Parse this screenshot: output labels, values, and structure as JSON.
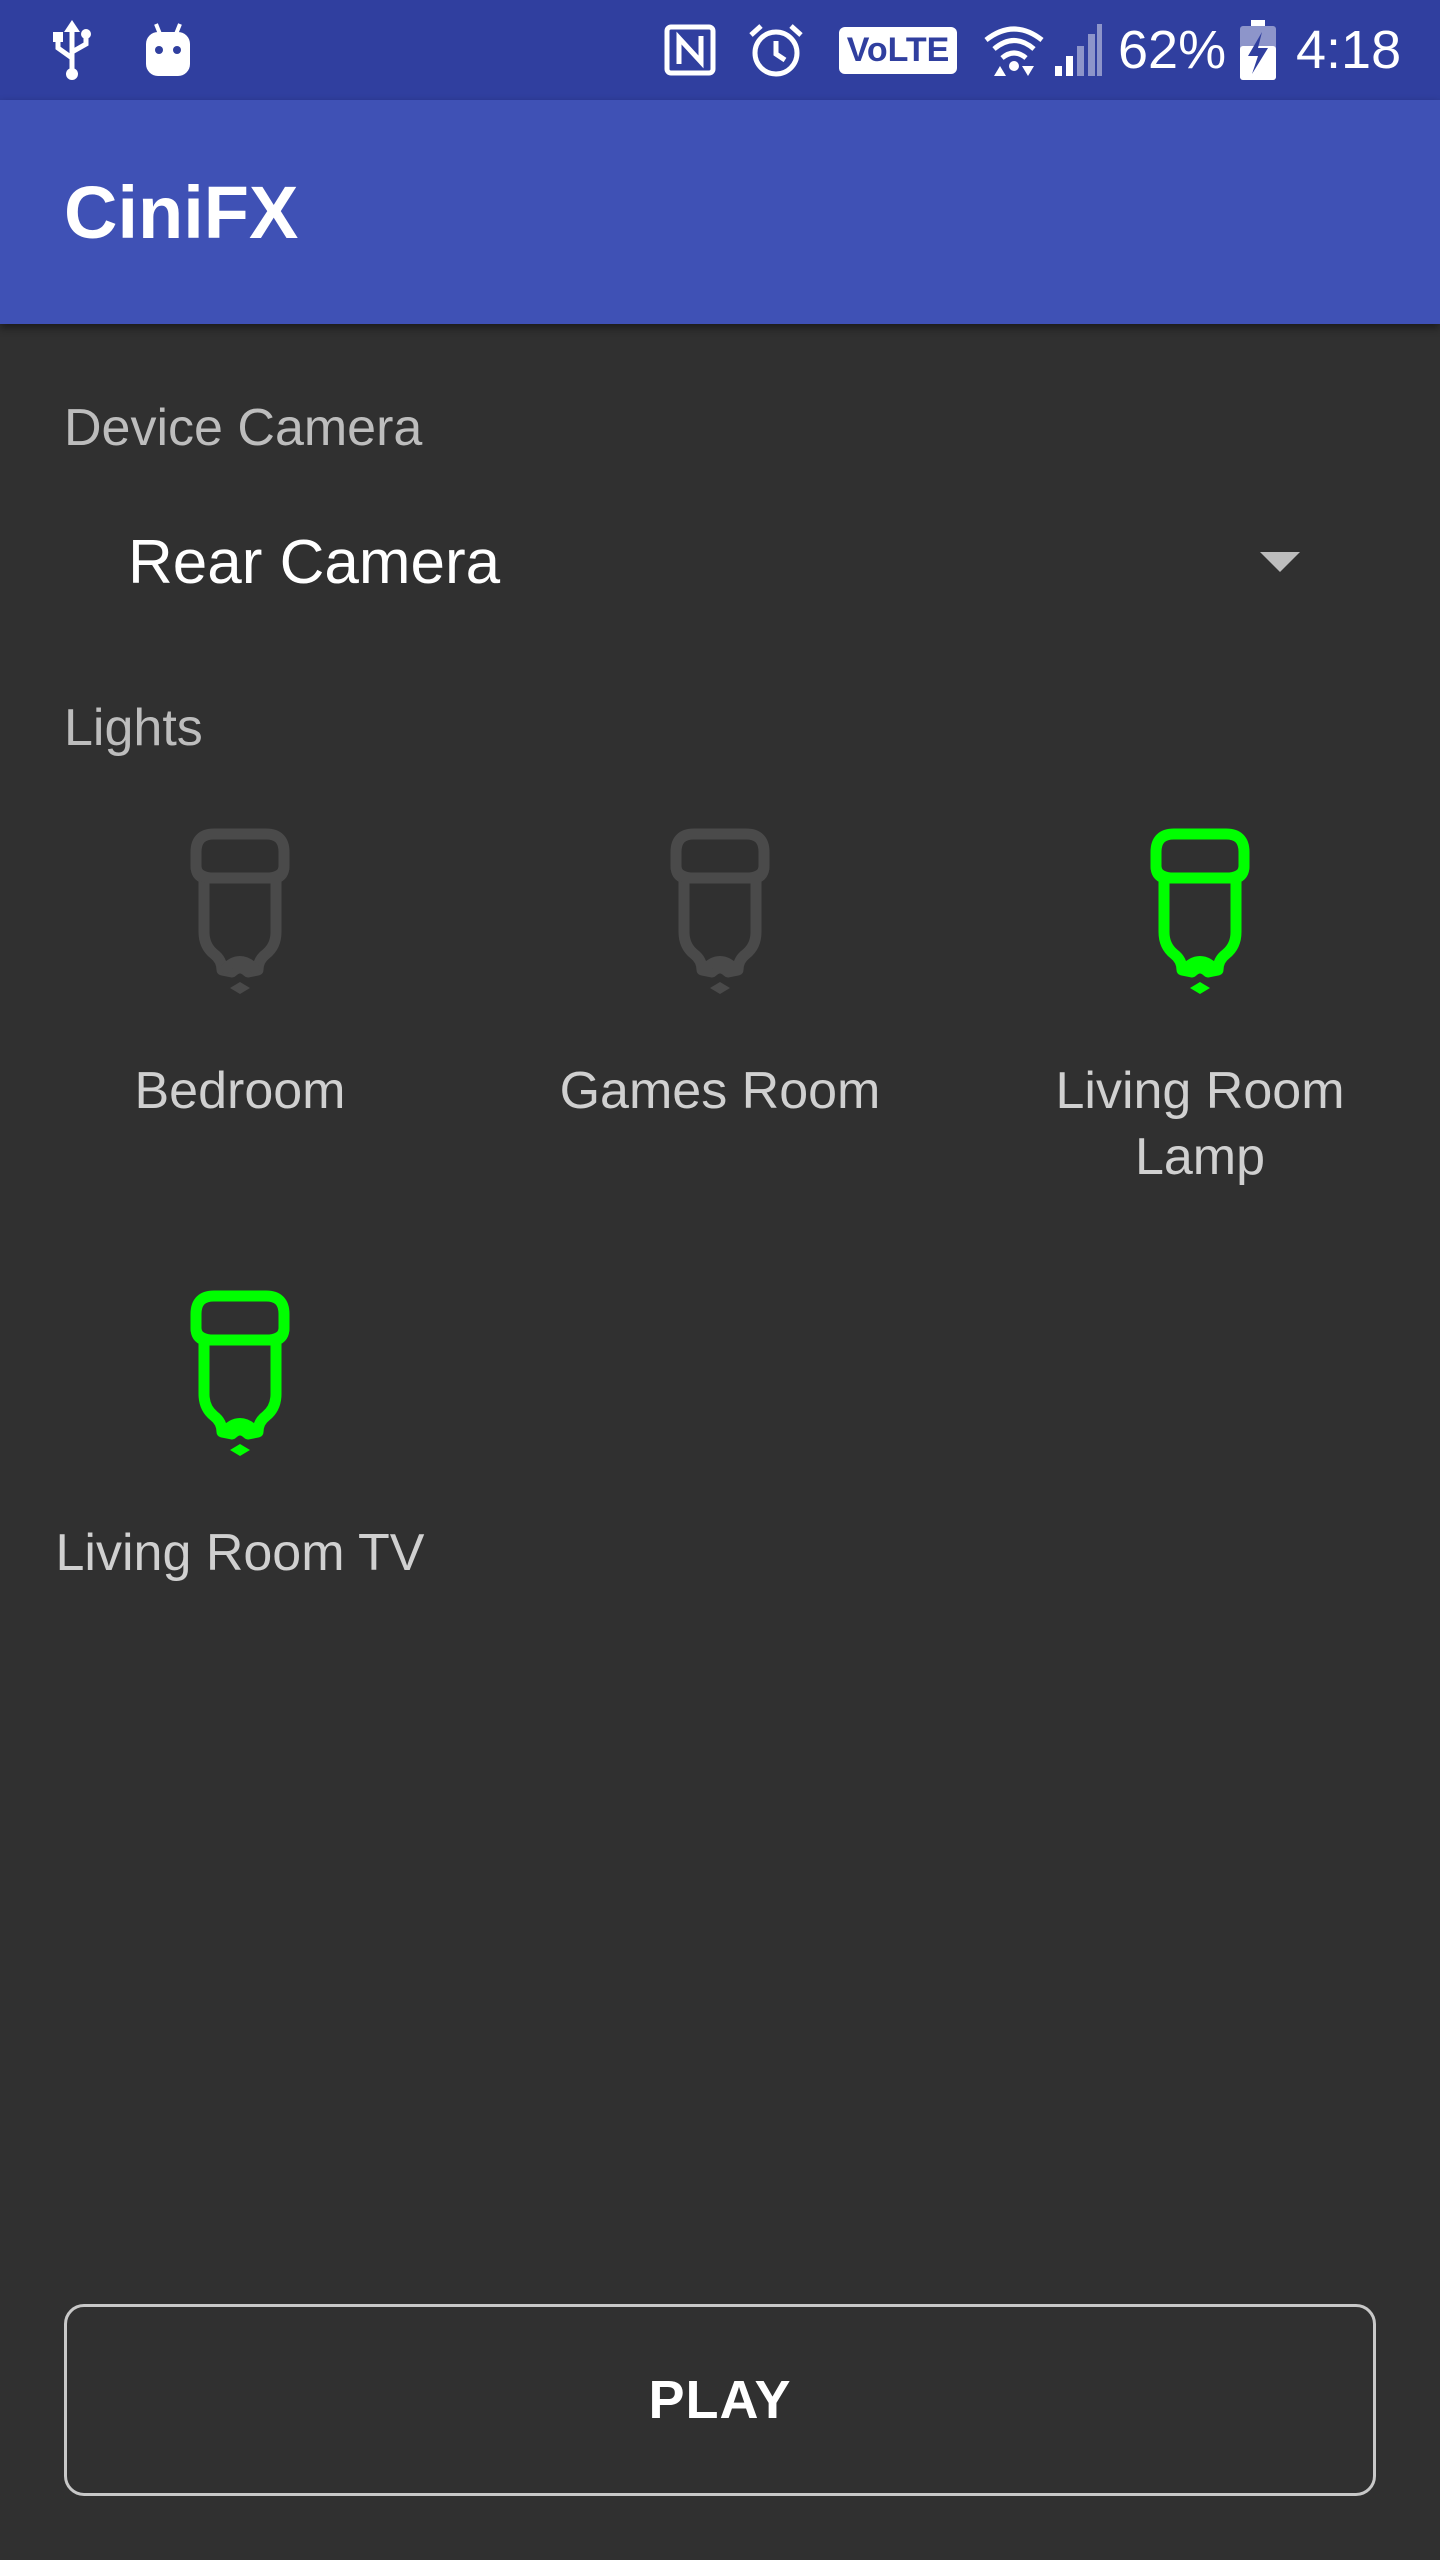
{
  "status_bar": {
    "battery_percent": "62%",
    "time": "4:18",
    "volte_label": "VoLTE",
    "icons": [
      "usb-icon",
      "android-debug-icon",
      "nfc-icon",
      "alarm-icon",
      "volte-icon",
      "wifi-icon",
      "cell-signal-icon",
      "battery-charging-icon"
    ]
  },
  "app_bar": {
    "title": "CiniFX"
  },
  "camera": {
    "label": "Device Camera",
    "selected": "Rear Camera"
  },
  "lights": {
    "label": "Lights",
    "items": [
      {
        "name": "Bedroom",
        "on": false
      },
      {
        "name": "Games Room",
        "on": false
      },
      {
        "name": "Living Room Lamp",
        "on": true
      },
      {
        "name": "Living Room TV",
        "on": true
      }
    ]
  },
  "play_button": {
    "label": "PLAY"
  },
  "colors": {
    "status_bar": "#303f9f",
    "app_bar": "#3f51b5",
    "background": "#303030",
    "light_on": "#00ff00",
    "light_off": "#4a4a4a"
  }
}
